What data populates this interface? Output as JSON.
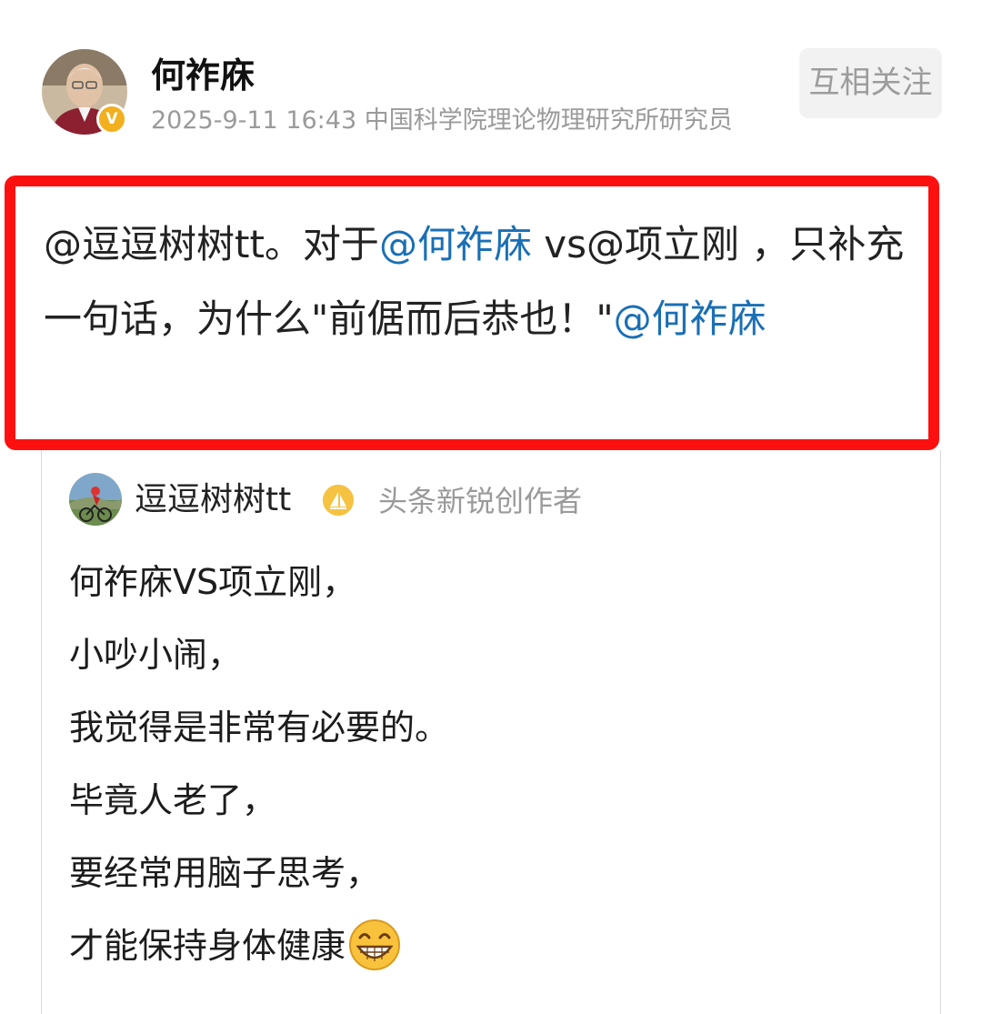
{
  "author": {
    "name": "何祚庥",
    "verified_mark": "V",
    "timestamp": "2025-9-11 16:43",
    "title": "中国科学院理论物理研究所研究员",
    "avatar_icon": "portrait-avatar-icon"
  },
  "follow_button": {
    "label": "互相关注"
  },
  "post": {
    "text_1": "@逗逗树树tt。对于",
    "mention_1": "@何祚庥",
    "text_2": " vs@项立刚 ，只补充一句话，为什么\"前倨而后恭也！\"",
    "mention_2": "@何祚庥"
  },
  "quoted_post": {
    "author_name": "逗逗树树tt",
    "author_badge_icon": "creator-badge-icon",
    "author_title": "头条新锐创作者",
    "lines": [
      "何祚庥VS项立刚，",
      "小吵小闹，",
      "我觉得是非常有必要的。",
      "毕竟人老了，",
      "要经常用脑子思考，",
      "才能保持身体健康"
    ],
    "trailing_emoji_icon": "grinning-face-icon"
  },
  "colors": {
    "highlight_border": "#ff1010",
    "mention_link": "#1a6fb5",
    "meta_gray": "#9a9a9a",
    "follow_button_bg": "#f2f2f2",
    "verified_badge": "#f2b01e"
  }
}
